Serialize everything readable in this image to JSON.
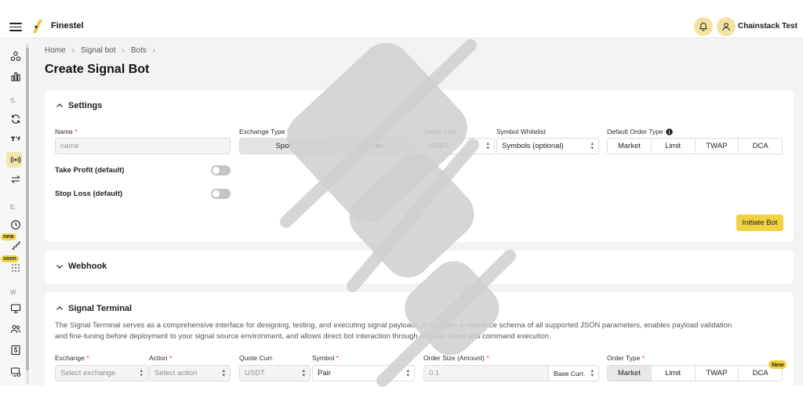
{
  "app": {
    "brand": "Finestel",
    "user_name": "Chainstack Test"
  },
  "sidebar": {
    "section_letters": [
      "S.",
      "E.",
      "W"
    ],
    "badges": {
      "new": "new",
      "soon": "soon"
    },
    "icons": [
      "nodes-icon",
      "bar-chart-icon",
      "sync-icon",
      "trading-view-icon",
      "signal-icon",
      "transfer-icon",
      "history-icon",
      "stairs-icon",
      "grid-icon",
      "monitor-icon",
      "users-icon",
      "dollar-icon",
      "monitor-settings-icon"
    ]
  },
  "breadcrumb": [
    "Home",
    "Signal bot",
    "Bots"
  ],
  "page_title": "Create Signal Bot",
  "settings": {
    "title": "Settings",
    "name_label": "Name",
    "name_placeholder": "name",
    "exchange_type_label": "Exchange Type",
    "exchange_types": [
      "Spot",
      "Futures"
    ],
    "exchange_type_selected": "Spot",
    "quote_label": "Quote Curr.",
    "quote_value": "USDT",
    "whitelist_label": "Symbol Whitelist",
    "whitelist_value": "Symbols (optional)",
    "order_type_label": "Default Order Type",
    "order_types": [
      "Market",
      "Limit",
      "TWAP",
      "DCA"
    ],
    "take_profit_label": "Take Profit (default)",
    "stop_loss_label": "Stop Loss (default)",
    "initiate_label": "Initiate Bot"
  },
  "webhook": {
    "title": "Webhook"
  },
  "terminal": {
    "title": "Signal Terminal",
    "description_line1": "The Signal Terminal serves as a comprehensive interface for designing, testing, and executing signal payloads. It provides a reference schema of all supported JSON parameters, enables payload validation",
    "description_line2": "and fine-tuning before deployment to your signal source environment, and allows direct bot interaction through manual signal and command execution.",
    "exchange_label": "Exchange",
    "exchange_placeholder": "Select exchange",
    "action_label": "Action",
    "action_placeholder": "Select action",
    "quote_label": "Quote Curr.",
    "quote_value": "USDT",
    "symbol_label": "Symbol",
    "symbol_value": "Pair",
    "order_size_label": "Order Size (Amount)",
    "order_size_value": "0.1",
    "base_curr_label": "Base Curr.",
    "order_type_label": "Order Type",
    "order_types": [
      "Market",
      "Limit",
      "TWAP",
      "DCA"
    ],
    "order_type_selected": "Market",
    "new_badge": "New"
  },
  "colors": {
    "accent": "#f2d13f",
    "badge_bg": "#f3e3a0",
    "watermark": "#cfcfcf"
  }
}
